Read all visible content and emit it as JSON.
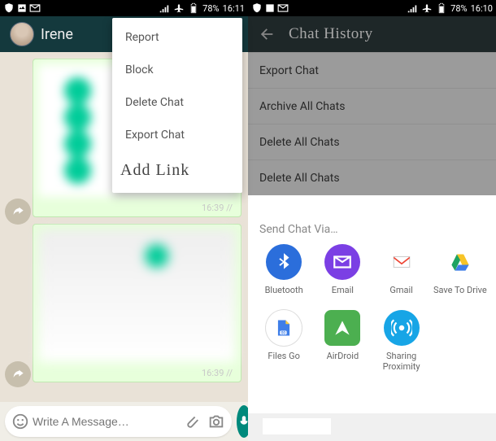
{
  "left": {
    "status": {
      "battery": "78%",
      "time": "16:11"
    },
    "contact": "Irene",
    "menu": {
      "items": [
        {
          "label": "Report"
        },
        {
          "label": "Block"
        },
        {
          "label": "Delete Chat"
        },
        {
          "label": "Export Chat"
        }
      ],
      "add_link": "Add Link"
    },
    "bubbles": [
      {
        "time": "16:39 //"
      },
      {
        "time": "16:39 //"
      }
    ],
    "input": {
      "placeholder": "Write A Message…"
    }
  },
  "right": {
    "status": {
      "battery": "78%",
      "time": "16:10"
    },
    "header": "Chat History",
    "list": [
      {
        "label": "Export Chat"
      },
      {
        "label": "Archive All Chats"
      },
      {
        "label": "Delete All Chats"
      },
      {
        "label": "Delete All Chats"
      }
    ],
    "share": {
      "title": "Send Chat Via…",
      "items": [
        {
          "label": "Bluetooth",
          "icon": "bluetooth"
        },
        {
          "label": "Email",
          "icon": "email"
        },
        {
          "label": "Gmail",
          "icon": "gmail"
        },
        {
          "label": "Save To Drive",
          "icon": "drive"
        },
        {
          "label": "Files Go",
          "icon": "filesgo"
        },
        {
          "label": "AirDroid",
          "icon": "airdroid"
        },
        {
          "label": "Sharing Proximity",
          "icon": "proximity"
        }
      ]
    }
  }
}
